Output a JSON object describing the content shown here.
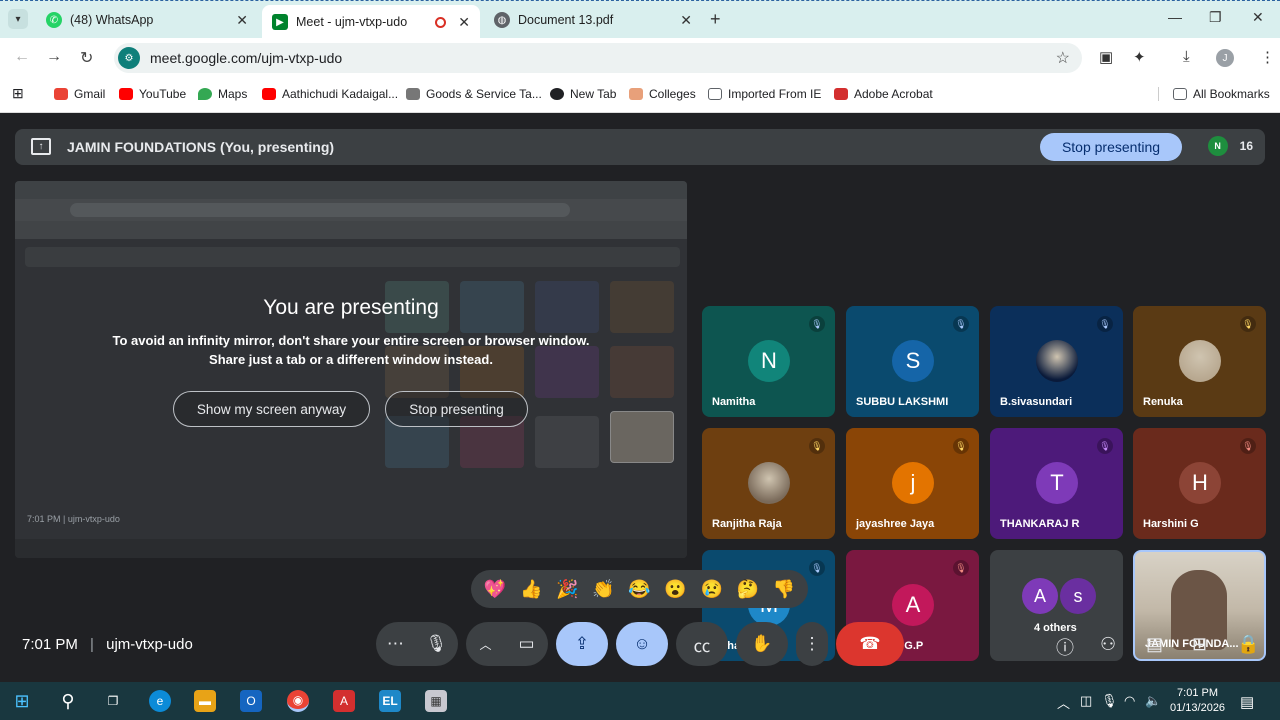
{
  "browser": {
    "tabs": [
      {
        "label": "(48) WhatsApp",
        "icon": "whatsapp-icon"
      },
      {
        "label": "Meet - ujm-vtxp-udo",
        "icon": "google-meet-icon"
      },
      {
        "label": "Document 13.pdf",
        "icon": "globe-icon"
      }
    ],
    "url": "meet.google.com/ujm-vtxp-udo",
    "profile_initial": "J",
    "bookmarks": [
      {
        "label": "Gmail",
        "color": "#ea4335"
      },
      {
        "label": "YouTube",
        "color": "#ff0000"
      },
      {
        "label": "Maps",
        "color": "#34a853"
      },
      {
        "label": "Aathichudi Kadaigal...",
        "color": "#ff0000"
      },
      {
        "label": "Goods & Service Ta...",
        "color": "#777777"
      },
      {
        "label": "New Tab",
        "color": "#202124"
      },
      {
        "label": "Colleges",
        "color": "#e8a07a"
      },
      {
        "label": "Imported From IE",
        "color": "#5f6368"
      },
      {
        "label": "Adobe Acrobat",
        "color": "#d32f2f"
      }
    ],
    "all_bookmarks": "All Bookmarks"
  },
  "meet": {
    "presenting_title": "JAMIN FOUNDATIONS (You, presenting)",
    "stop_presenting": "Stop presenting",
    "participant_count": "16",
    "overlay": {
      "heading": "You are presenting",
      "line1": "To avoid an infinity mirror, don't share your entire screen or browser window.",
      "line2": "Share just a tab or a different window instead.",
      "show_anyway": "Show my screen anyway",
      "stop": "Stop presenting"
    },
    "tiles": [
      {
        "name": "Namitha",
        "initial": "N",
        "bg": "#0d5550",
        "avatar": "#11857a"
      },
      {
        "name": "SUBBU LAKSHMI",
        "initial": "S",
        "bg": "#0a4a6e",
        "avatar": "#1565a8"
      },
      {
        "name": "B.sivasundari",
        "initial": "",
        "bg": "#0b2f5a",
        "avatar": "#0a1a3a"
      },
      {
        "name": "Renuka",
        "initial": "",
        "bg": "#5a3a14",
        "avatar": "#b8a890"
      },
      {
        "name": "Ranjitha Raja",
        "initial": "",
        "bg": "#6e3f10",
        "avatar": "#7a6a5a"
      },
      {
        "name": "jayashree Jaya",
        "initial": "j",
        "bg": "#8a4506",
        "avatar": "#e37400"
      },
      {
        "name": "THANKARAJ R",
        "initial": "T",
        "bg": "#4d1a7a",
        "avatar": "#7e3ab8"
      },
      {
        "name": "Harshini G",
        "initial": "H",
        "bg": "#6a2a1c",
        "avatar": "#8c4436"
      },
      {
        "name": "Maha Lakshmi",
        "initial": "M",
        "bg": "#0a4a6e",
        "avatar": "#1e88c8"
      },
      {
        "name": "Akshaya G.P",
        "initial": "A",
        "bg": "#7a1840",
        "avatar": "#c2185b"
      },
      {
        "name": "4 others",
        "initial": "",
        "bg": "#3c4043",
        "avatar": "#7e3ab8"
      },
      {
        "name": "JAMIN FOUNDA...",
        "initial": "",
        "bg": "#c0b8a8",
        "avatar": ""
      }
    ],
    "others_initials": [
      "A",
      "s"
    ],
    "reactions": [
      "💖",
      "👍",
      "🎉",
      "👏",
      "😂",
      "😮",
      "😢",
      "🤔",
      "👎"
    ],
    "meeting_time": "7:01 PM",
    "meeting_code": "ujm-vtxp-udo",
    "preview_time": "7:01 PM  |  ujm-vtxp-udo"
  },
  "taskbar": {
    "time": "7:01 PM",
    "date": "01/13/2026"
  }
}
